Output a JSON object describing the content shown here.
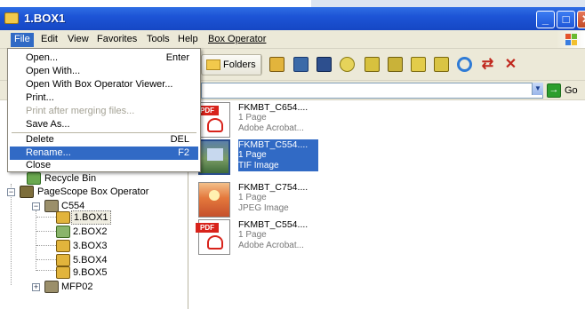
{
  "window": {
    "title": "1.BOX1"
  },
  "menubar": {
    "items": [
      "File",
      "Edit",
      "View",
      "Favorites",
      "Tools",
      "Help",
      "Box Operator"
    ]
  },
  "toolbar": {
    "folders_label": "Folders"
  },
  "addressbar": {
    "go_label": "Go"
  },
  "file_menu": {
    "items": [
      {
        "label": "Open...",
        "shortcut": "Enter"
      },
      {
        "label": "Open With...",
        "shortcut": ""
      },
      {
        "label": "Open With Box Operator Viewer...",
        "shortcut": ""
      },
      {
        "label": "Print...",
        "shortcut": ""
      },
      {
        "label": "Print after merging files...",
        "shortcut": ""
      },
      {
        "label": "Save As...",
        "shortcut": ""
      },
      {
        "label": "Delete",
        "shortcut": "DEL"
      },
      {
        "label": "Rename...",
        "shortcut": "F2"
      },
      {
        "label": "Close",
        "shortcut": ""
      }
    ]
  },
  "tree": {
    "items": [
      {
        "label": "Recycle Bin"
      },
      {
        "label": "PageScope Box Operator"
      },
      {
        "label": "C554"
      },
      {
        "label": "1.BOX1"
      },
      {
        "label": "2.BOX2"
      },
      {
        "label": "3.BOX3"
      },
      {
        "label": "5.BOX4"
      },
      {
        "label": "9.BOX5"
      },
      {
        "label": "MFP02"
      }
    ]
  },
  "files": [
    {
      "name": "FKMBT_C654....",
      "pages": "1 Page",
      "type": "Adobe Acrobat..."
    },
    {
      "name": "FKMBT_C554....",
      "pages": "1 Page",
      "type": "TIF Image"
    },
    {
      "name": "FKMBT_C754....",
      "pages": "1 Page",
      "type": "JPEG Image"
    },
    {
      "name": "FKMBT_C554....",
      "pages": "1 Page",
      "type": "Adobe Acrobat..."
    }
  ],
  "colors": {
    "titlebar": "#1d54d6",
    "selection": "#316ac5",
    "chrome": "#ece9d8"
  }
}
